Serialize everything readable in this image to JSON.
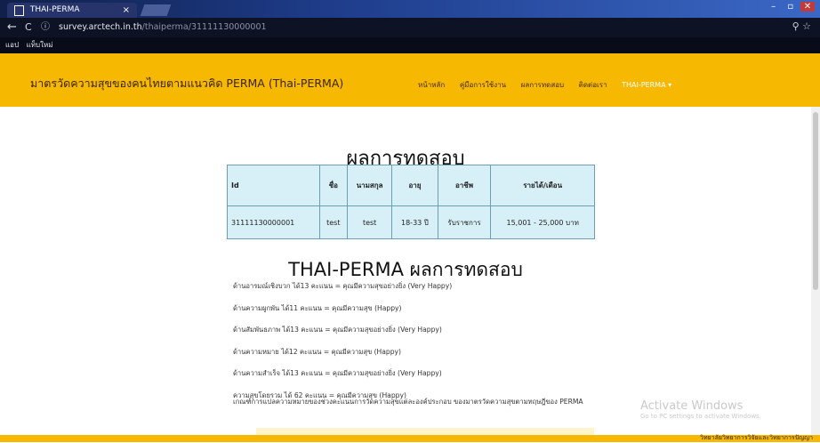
{
  "browser": {
    "tab_title": "THAI-PERMA",
    "tab_close": "×",
    "window_controls": [
      "–",
      "▫",
      "✕"
    ],
    "back_icon": "←",
    "reload_icon": "C",
    "info_icon": "ⓘ",
    "url_host": "survey.arctech.in.th",
    "url_path": "/thaiperma/31111130000001",
    "zoom_icon": "⚲",
    "star_icon": "☆",
    "bookmarks": [
      "แอป",
      "แท็บใหม่"
    ]
  },
  "site": {
    "brand": "มาตรวัดความสุขของคนไทยตามแนวคิด PERMA (Thai-PERMA)",
    "menu": [
      "หน้าหลัก",
      "คู่มือการใช้งาน",
      "ผลการทดสอบ",
      "ติดต่อเรา",
      "THAI-PERMA ▾"
    ]
  },
  "result": {
    "title": "ผลการทดสอบ",
    "columns": [
      "Id",
      "ชื่อ",
      "นามสกุล",
      "อายุ",
      "อาชีพ",
      "รายได้/เดือน"
    ],
    "row": [
      "31111130000001",
      "test",
      "test",
      "18-33 ปี",
      "รับราชการ",
      "15,001 - 25,000 บาท"
    ]
  },
  "perma": {
    "title": "THAI-PERMA ผลการทดสอบ",
    "lines": [
      "ด้านอารมณ์เชิงบวก ได้13 คะแนน = คุณมีความสุขอย่างยิ่ง (Very Happy)",
      "ด้านความผูกพัน ได้11 คะแนน = คุณมีความสุข (Happy)",
      "ด้านสัมพันธภาพ ได้13 คะแนน = คุณมีความสุขอย่างยิ่ง (Very Happy)",
      "ด้านความหมาย ได้12 คะแนน = คุณมีความสุข (Happy)",
      "ด้านความสำเร็จ ได้13 คะแนน = คุณมีความสุขอย่างยิ่ง (Very Happy)",
      "ความสุขโดยรวม ได้ 62 คะแนน = คุณมีความสุข (Happy)"
    ],
    "note": "เกณฑ์การแปลความหมายของช่วงคะแนนการวัดความสุขแต่ละองค์ประกอบ ของมาตรวัดความสุขตามทฤษฎีของ PERMA"
  },
  "watermark": {
    "title": "Activate Windows",
    "subtitle": "Go to PC settings to activate Windows."
  },
  "footer": {
    "text": "วิทยาลัยวิทยาการวิจัยและวิทยาการปัญญา"
  }
}
